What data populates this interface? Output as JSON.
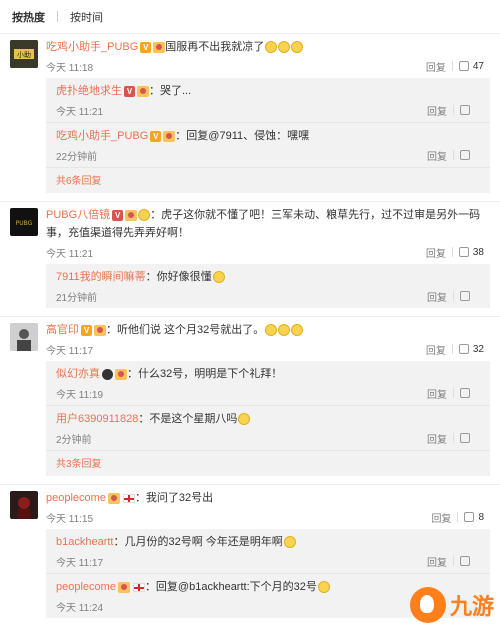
{
  "sort": {
    "hot": "按热度",
    "time": "按时间"
  },
  "comments": [
    {
      "user": "吃鸡小助手_PUBG",
      "text": "国服再不出我就凉了",
      "time": "今天 11:18",
      "reply": "回复",
      "likes": "47",
      "replies": [
        {
          "user": "虎扑绝地求生",
          "text": "：哭了...",
          "time": "今天 11:21",
          "reply": "回复"
        },
        {
          "user": "吃鸡小助手_PUBG",
          "text": "：回复@7911、侵蚀：嘿嘿",
          "time": "22分钟前",
          "reply": "回复"
        }
      ],
      "more": "共6条回复"
    },
    {
      "user": "PUBG八倍镜",
      "text": "：虎子这你就不懂了吧！三军未动、粮草先行，过不过审是另外一码事，充值渠道得先弄弄好啊！",
      "time": "今天 11:21",
      "reply": "回复",
      "likes": "38",
      "replies": [
        {
          "user": "7911我的瞬间嘛蒂",
          "text": "：你好像很懂",
          "time": "21分钟前",
          "reply": "回复"
        }
      ]
    },
    {
      "user": "高官印",
      "text": "：听他们说 这个月32号就出了。",
      "time": "今天 11:17",
      "reply": "回复",
      "likes": "32",
      "replies": [
        {
          "user": "似幻亦真",
          "text": "：什么32号，明明是下个礼拜！",
          "time": "今天 11:19",
          "reply": "回复"
        },
        {
          "user": "用户6390911828",
          "text": "：不是这个星期八吗",
          "time": "2分钟前",
          "reply": "回复"
        }
      ],
      "more": "共3条回复"
    },
    {
      "user": "peoplecome",
      "text": "：我问了32号出",
      "time": "今天 11:15",
      "reply": "回复",
      "likes": "8",
      "replies": [
        {
          "user": "b1ackheartt",
          "text": "：几月份的32号啊 今年还是明年啊",
          "time": "今天 11:17",
          "reply": "回复"
        },
        {
          "user": "peoplecome",
          "text": "：回复@b1ackheartt:下个月的32号",
          "time": "今天 11:24",
          "reply": "回复"
        }
      ]
    }
  ],
  "watermark": "九游",
  "colors": {
    "username": "#eb7350",
    "watermark": "#ff7f1a"
  }
}
